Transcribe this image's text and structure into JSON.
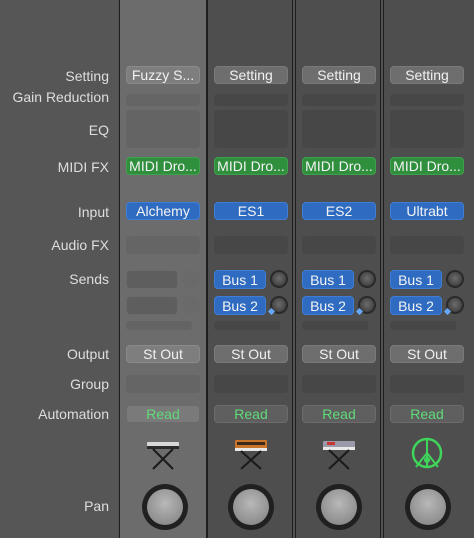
{
  "row_labels": {
    "setting": "Setting",
    "gain_reduction": "Gain Reduction",
    "eq": "EQ",
    "midi_fx": "MIDI FX",
    "input": "Input",
    "audio_fx": "Audio FX",
    "sends": "Sends",
    "output": "Output",
    "group": "Group",
    "automation": "Automation",
    "pan": "Pan"
  },
  "strips": [
    {
      "setting": "Fuzzy S...",
      "midi_fx": "MIDI Dro...",
      "input": "Alchemy",
      "send1": "",
      "send2": "",
      "output": "St Out",
      "automation": "Read",
      "icon": "synth-keyboard-icon"
    },
    {
      "setting": "Setting",
      "midi_fx": "MIDI Dro...",
      "input": "ES1",
      "send1": "Bus 1",
      "send2": "Bus 2",
      "output": "St Out",
      "automation": "Read",
      "icon": "analog-synth-icon"
    },
    {
      "setting": "Setting",
      "midi_fx": "MIDI Dro...",
      "input": "ES2",
      "send1": "Bus 1",
      "send2": "Bus 2",
      "output": "St Out",
      "automation": "Read",
      "icon": "synth-keyboard-icon"
    },
    {
      "setting": "Setting",
      "midi_fx": "MIDI Dro...",
      "input": "Ultrabt",
      "send1": "Bus 1",
      "send2": "Bus 2",
      "output": "St Out",
      "automation": "Read",
      "icon": "drum-circle-icon"
    }
  ],
  "colors": {
    "midi_fx": "#2f8f3d",
    "input": "#2f6cc1",
    "read_text": "#5fdc78"
  }
}
